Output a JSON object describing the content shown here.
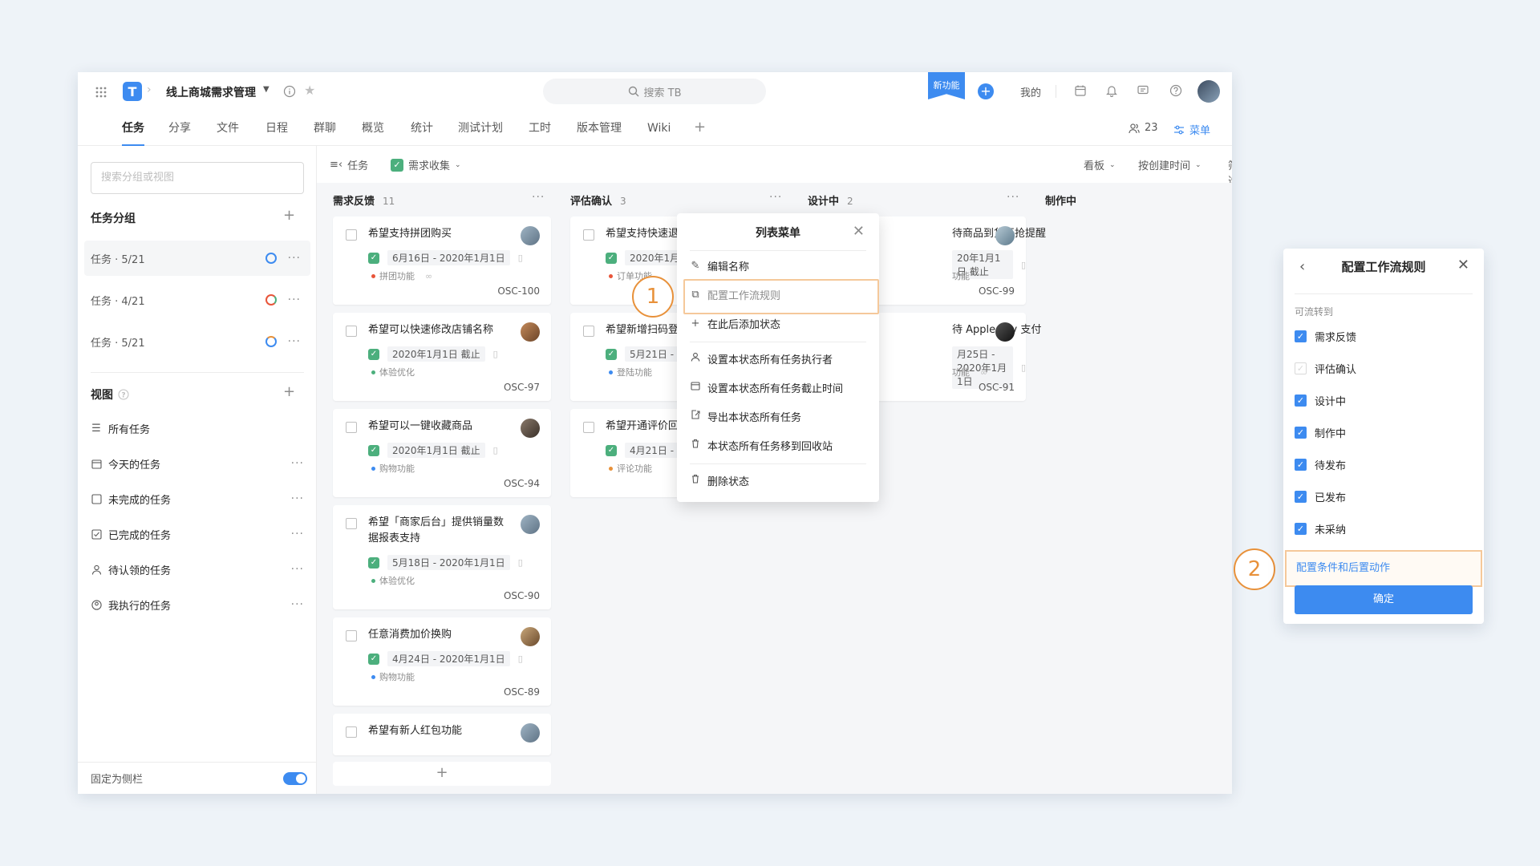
{
  "header": {
    "logo": "T",
    "project_title": "线上商城需求管理",
    "search_placeholder": "搜索 TB",
    "new_feature_badge": "新功能",
    "mine_label": "我的"
  },
  "tabs": [
    "任务",
    "分享",
    "文件",
    "日程",
    "群聊",
    "概览",
    "统计",
    "测试计划",
    "工时",
    "版本管理",
    "Wiki"
  ],
  "member_count": "23",
  "menu_label": "菜单",
  "sidebar": {
    "search_placeholder": "搜索分组或视图",
    "groups_heading": "任务分组",
    "groups": [
      {
        "label": "任务 · 5/21",
        "ring_color": "#3d8bf0"
      },
      {
        "label": "任务 · 4/21",
        "ring_color": "#e8553a"
      },
      {
        "label": "任务 · 5/21",
        "ring_color": "#3d8bf0"
      }
    ],
    "views_heading": "视图",
    "views": [
      "所有任务",
      "今天的任务",
      "未完成的任务",
      "已完成的任务",
      "待认领的任务",
      "我执行的任务"
    ],
    "pin_label": "固定为侧栏"
  },
  "board_header": {
    "task_label": "任务",
    "collection_label": "需求收集",
    "view_mode": "看板",
    "sort_label": "按创建时间",
    "filter_label": "筛选"
  },
  "columns": [
    {
      "title": "需求反馈",
      "count": "11"
    },
    {
      "title": "评估确认",
      "count": "3"
    },
    {
      "title": "设计中",
      "count": "2"
    },
    {
      "title": "制作中",
      "count": ""
    }
  ],
  "cards_col1": [
    {
      "title": "希望支持拼团购买",
      "date": "6月16日 - 2020年1月1日",
      "tag": "拼团功能",
      "tag_color": "#e8553a",
      "code": "OSC-100"
    },
    {
      "title": "希望可以快速修改店铺名称",
      "date": "2020年1月1日 截止",
      "tag": "体验优化",
      "tag_color": "#4caf7d",
      "code": "OSC-97"
    },
    {
      "title": "希望可以一键收藏商品",
      "date": "2020年1月1日 截止",
      "tag": "购物功能",
      "tag_color": "#3d8bf0",
      "code": "OSC-94"
    },
    {
      "title": "希望「商家后台」提供销量数据报表支持",
      "date": "5月18日 - 2020年1月1日",
      "tag": "体验优化",
      "tag_color": "#4caf7d",
      "code": "OSC-90"
    },
    {
      "title": "任意消费加价换购",
      "date": "4月24日 - 2020年1月1日",
      "tag": "购物功能",
      "tag_color": "#3d8bf0",
      "code": "OSC-89"
    },
    {
      "title": "希望有新人红包功能"
    }
  ],
  "cards_col2": [
    {
      "title": "希望支持快速退",
      "date": "2020年1月",
      "tag": "订单功能",
      "tag_color": "#e8553a"
    },
    {
      "title": "希望新增扫码登",
      "date": "5月21日 -",
      "tag": "登陆功能",
      "tag_color": "#3d8bf0"
    },
    {
      "title": "希望开通评价回",
      "date": "4月21日 -",
      "tag": "评论功能",
      "tag_color": "#e8913a"
    }
  ],
  "cards_col3": [
    {
      "title": "待商品到货开抢提醒",
      "date": "20年1月1日 截止",
      "tag": "功能",
      "code": "OSC-99"
    },
    {
      "title": "待 Apple Pay 支付",
      "date": "月25日 - 2020年1月1日",
      "tag": "功能",
      "code": "OSC-91"
    }
  ],
  "context_menu": {
    "title": "列表菜单",
    "items": [
      "编辑名称",
      "配置工作流规则",
      "在此后添加状态",
      "设置本状态所有任务执行者",
      "设置本状态所有任务截止时间",
      "导出本状态所有任务",
      "本状态所有任务移到回收站",
      "删除状态"
    ]
  },
  "callouts": [
    "1",
    "2"
  ],
  "workflow_panel": {
    "title": "配置工作流规则",
    "subtitle": "可流转到",
    "options": [
      {
        "label": "需求反馈",
        "checked": true
      },
      {
        "label": "评估确认",
        "checked": false
      },
      {
        "label": "设计中",
        "checked": true
      },
      {
        "label": "制作中",
        "checked": true
      },
      {
        "label": "待发布",
        "checked": true
      },
      {
        "label": "已发布",
        "checked": true
      },
      {
        "label": "未采纳",
        "checked": true
      }
    ],
    "condition_link": "配置条件和后置动作",
    "confirm_label": "确定"
  }
}
